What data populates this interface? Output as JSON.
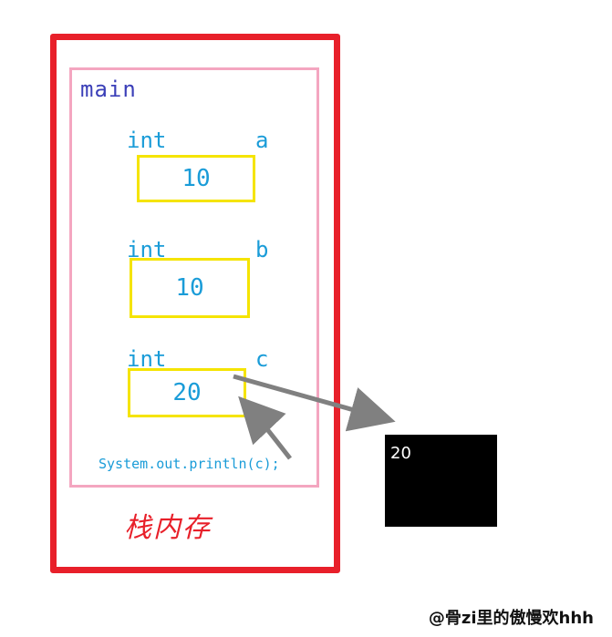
{
  "frame": {
    "name": "main",
    "caption": "栈内存",
    "variables": [
      {
        "type": "int",
        "name": "a",
        "value": "10"
      },
      {
        "type": "int",
        "name": "b",
        "value": "10"
      },
      {
        "type": "int",
        "name": "c",
        "value": "20"
      }
    ],
    "statement": "System.out.println(c);"
  },
  "console": {
    "output": "20"
  },
  "watermark": "@骨zi里的傲慢欢hhh",
  "colors": {
    "stack_border": "#e8202a",
    "main_border": "#f4a6c0",
    "variable_box": "#f5e400",
    "text": "#1a9cd8",
    "arrow": "#808080",
    "console_bg": "#000000"
  }
}
